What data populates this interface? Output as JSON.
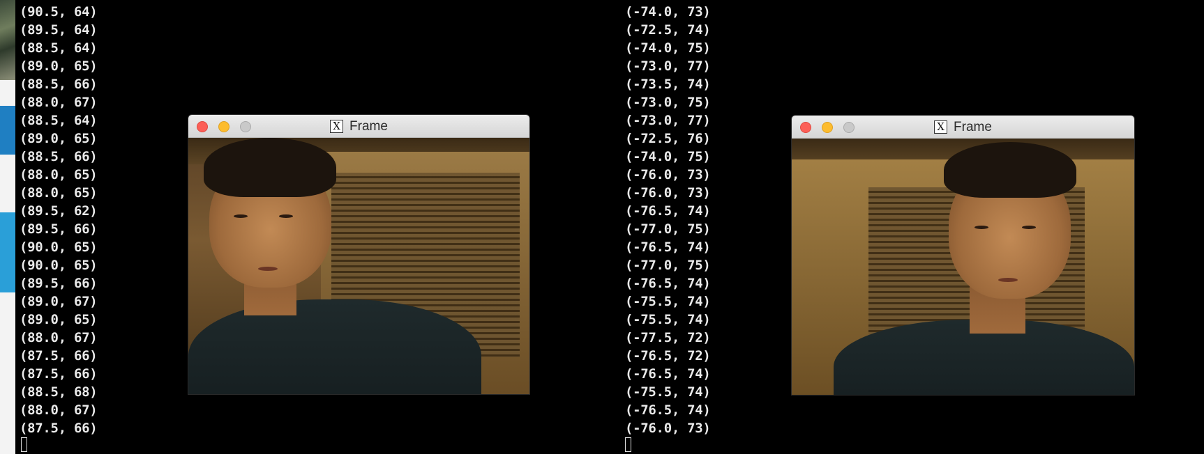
{
  "left_terminal": {
    "lines": [
      "(90.5, 64)",
      "(89.5, 64)",
      "(88.5, 64)",
      "(89.0, 65)",
      "(88.5, 66)",
      "(88.0, 67)",
      "(88.5, 64)",
      "(89.0, 65)",
      "(88.5, 66)",
      "(88.0, 65)",
      "(88.0, 65)",
      "(89.5, 62)",
      "(89.5, 66)",
      "(90.0, 65)",
      "(90.0, 65)",
      "(89.5, 66)",
      "(89.0, 67)",
      "(89.0, 65)",
      "(88.0, 67)",
      "(87.5, 66)",
      "(87.5, 66)",
      "(88.5, 68)",
      "(88.0, 67)",
      "(87.5, 66)"
    ]
  },
  "right_terminal": {
    "lines": [
      "(-74.0, 73)",
      "(-72.5, 74)",
      "(-74.0, 75)",
      "(-73.0, 77)",
      "(-73.5, 74)",
      "(-73.0, 75)",
      "(-73.0, 77)",
      "(-72.5, 76)",
      "(-74.0, 75)",
      "(-76.0, 73)",
      "(-76.0, 73)",
      "(-76.5, 74)",
      "(-77.0, 75)",
      "(-76.5, 74)",
      "(-77.0, 75)",
      "(-76.5, 74)",
      "(-75.5, 74)",
      "(-75.5, 74)",
      "(-77.5, 72)",
      "(-76.5, 72)",
      "(-76.5, 74)",
      "(-75.5, 74)",
      "(-76.5, 74)",
      "(-76.0, 73)"
    ]
  },
  "windows": [
    {
      "title": "Frame",
      "app_icon": "x11-icon"
    },
    {
      "title": "Frame",
      "app_icon": "x11-icon"
    }
  ],
  "colors": {
    "terminal_bg": "#000000",
    "terminal_text": "#e9e9e9",
    "close": "#fc5f57",
    "minimize": "#fdbc2e",
    "zoom": "#c9c9c9"
  }
}
